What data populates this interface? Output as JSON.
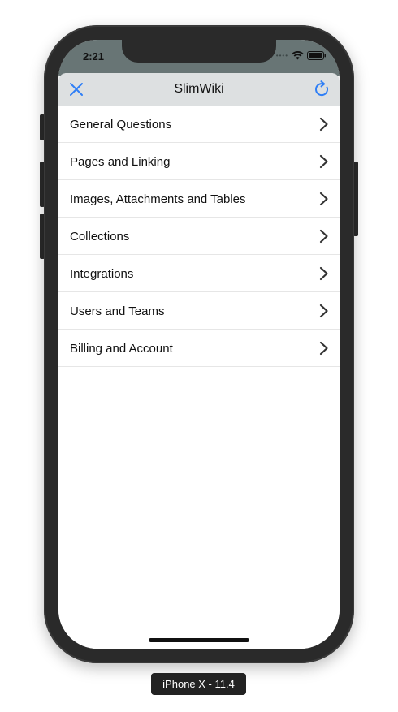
{
  "status_bar": {
    "time": "2:21",
    "signal_icon": "cellular-dots-icon",
    "wifi_icon": "wifi-icon",
    "battery_icon": "battery-icon"
  },
  "navbar": {
    "title": "SlimWiki",
    "close_icon": "close-icon",
    "refresh_icon": "refresh-icon",
    "accent_color": "#2f7ff6"
  },
  "menu": {
    "items": [
      {
        "label": "General Questions"
      },
      {
        "label": "Pages and Linking"
      },
      {
        "label": "Images, Attachments and Tables"
      },
      {
        "label": "Collections"
      },
      {
        "label": "Integrations"
      },
      {
        "label": "Users and Teams"
      },
      {
        "label": "Billing and Account"
      }
    ],
    "chevron_icon": "chevron-right-icon"
  },
  "simulator": {
    "device_label": "iPhone X - 11.4"
  }
}
